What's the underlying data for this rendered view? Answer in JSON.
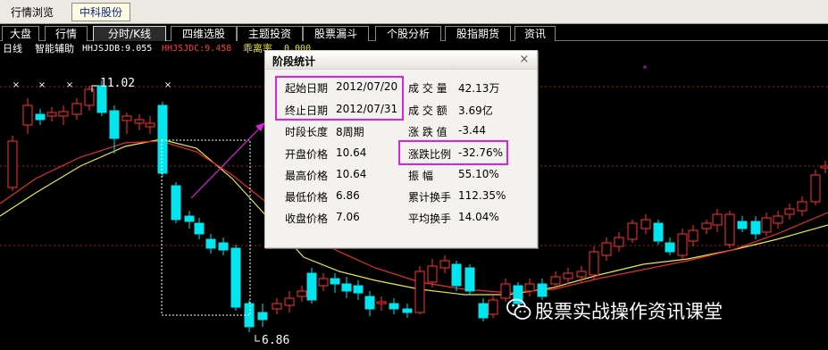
{
  "toolbar": {
    "market_browse": "行情浏览",
    "stock_name": "中科股份"
  },
  "tabs": [
    {
      "label": "大盘",
      "active": false
    },
    {
      "label": "行情",
      "active": false
    },
    {
      "label": "分时/K线",
      "active": true
    },
    {
      "label": "四维选股",
      "active": false
    },
    {
      "label": "主题投资",
      "active": false
    },
    {
      "label": "股票漏斗",
      "active": false
    },
    {
      "label": "个股分析",
      "active": false
    },
    {
      "label": "股指期货",
      "active": false
    },
    {
      "label": "资讯",
      "active": false
    }
  ],
  "indicator_bar": {
    "period": "日线",
    "helper": "智能辅助",
    "ind1": "HHJSJDB:9.055",
    "ind2": "HHJSJDC:9.458",
    "ind3_label": "乖离率",
    "ind3_value": "0.000"
  },
  "chart": {
    "high_label": "11.02",
    "low_label": "6.86",
    "colors": {
      "up": "#ff3232",
      "down": "#00e5ee",
      "ma_yellow": "#e8e84a",
      "ma_red": "#e03030",
      "grid": "#a02020",
      "selection": "#ffffff",
      "arrow": "#e020e0"
    }
  },
  "dialog": {
    "title": "阶段统计",
    "close_icon": "close-icon",
    "left": [
      {
        "label": "起始日期",
        "value": "2012/07/20"
      },
      {
        "label": "终止日期",
        "value": "2012/07/31"
      },
      {
        "label": "时段长度",
        "value": "8周期"
      },
      {
        "label": "开盘价格",
        "value": "10.64"
      },
      {
        "label": "最高价格",
        "value": "10.64"
      },
      {
        "label": "最低价格",
        "value": "6.86"
      },
      {
        "label": "收盘价格",
        "value": "7.06"
      }
    ],
    "right": [
      {
        "label": "成 交 量",
        "value": "42.13万"
      },
      {
        "label": "成 交 额",
        "value": "3.69亿"
      },
      {
        "label": "涨 跌 值",
        "value": "-3.44"
      },
      {
        "label": "涨跌比例",
        "value": "-32.76%"
      },
      {
        "label": "振    幅",
        "value": "55.10%"
      },
      {
        "label": "累计换手",
        "value": "112.35%"
      },
      {
        "label": "平均换手",
        "value": "14.04%"
      }
    ]
  },
  "watermark": {
    "text": "股票实战操作资讯课堂",
    "icon": "wechat-icon"
  }
}
